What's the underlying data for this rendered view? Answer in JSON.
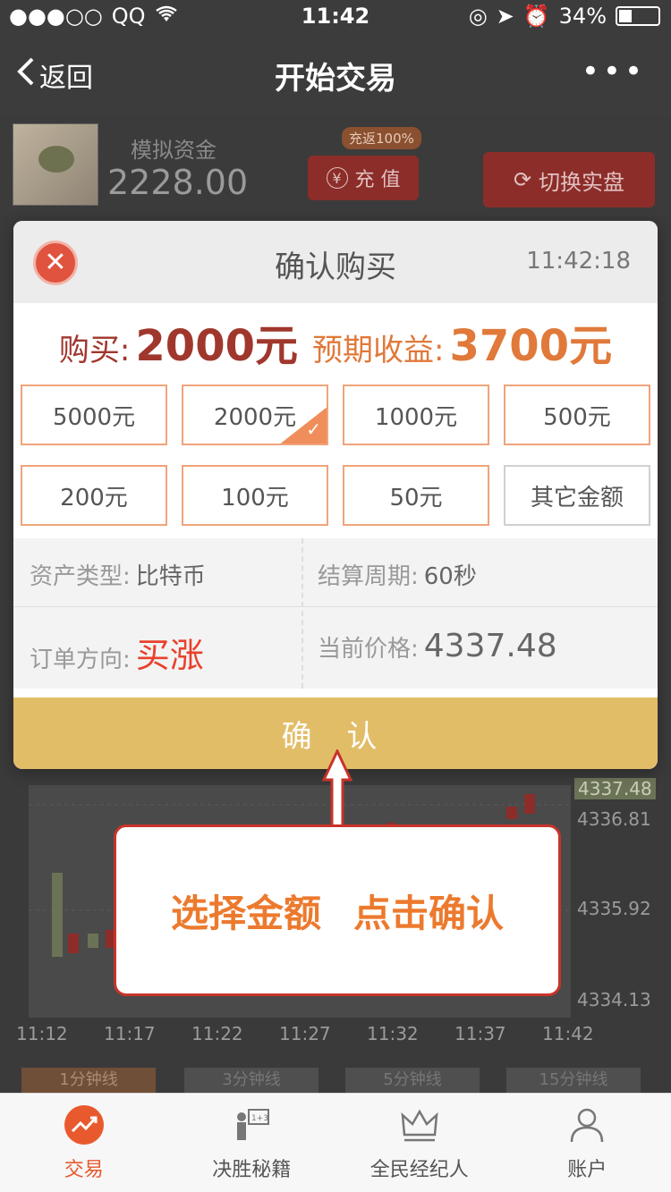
{
  "status_bar": {
    "carrier": "QQ",
    "signal": "●●●○○",
    "time": "11:42",
    "battery": "34%",
    "battery_level": 0.34
  },
  "nav": {
    "back_label": "返回",
    "title": "开始交易",
    "more": "•••"
  },
  "account": {
    "sim_label": "模拟资金",
    "sim_amount": "2228.00",
    "cashback_badge": "充返100%",
    "recharge_icon": "¥",
    "recharge_label": "充 值",
    "switch_label": "切换实盘"
  },
  "modal": {
    "title": "确认购买",
    "time": "11:42:18",
    "buy_label": "购买:",
    "buy_amount": "2000元",
    "expect_label": "预期收益:",
    "expect_amount": "3700元",
    "amount_options": [
      "5000元",
      "2000元",
      "1000元",
      "500元",
      "200元",
      "100元",
      "50元",
      "其它金额"
    ],
    "selected_amount": "2000元",
    "asset_type_label": "资产类型:",
    "asset_type_value": "比特币",
    "period_label": "结算周期:",
    "period_value": "60秒",
    "direction_label": "订单方向:",
    "direction_value": "买涨",
    "price_label": "当前价格:",
    "price_value": "4337.48",
    "confirm_label": "确 认"
  },
  "hint": {
    "part1": "选择金额",
    "part2": "点击确认"
  },
  "chart": {
    "price_ticks": [
      "4337.48",
      "4336.81",
      "4335.92",
      "4334.13"
    ],
    "time_ticks": [
      "11:12",
      "11:17",
      "11:22",
      "11:27",
      "11:32",
      "11:37",
      "11:42"
    ]
  },
  "period_tabs": [
    "1分钟线",
    "3分钟线",
    "5分钟线",
    "15分钟线"
  ],
  "tab_bar": [
    {
      "label": "交易",
      "icon": "trade-icon",
      "active": true
    },
    {
      "label": "决胜秘籍",
      "icon": "teacher-icon",
      "active": false
    },
    {
      "label": "全民经纪人",
      "icon": "crown-icon",
      "active": false
    },
    {
      "label": "账户",
      "icon": "user-icon",
      "active": false
    }
  ],
  "colors": {
    "accent_orange": "#e85a2e",
    "confirm_yellow": "#e2bd68",
    "close_red": "#e0533e",
    "price_red": "#a0372d"
  }
}
